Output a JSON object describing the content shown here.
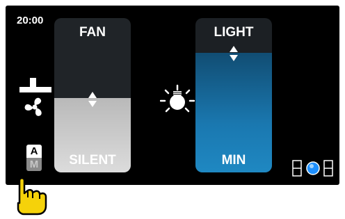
{
  "status": {
    "time": "20:00"
  },
  "fan": {
    "title": "FAN",
    "value_label": "SILENT",
    "level_percent": 48
  },
  "light": {
    "title": "LIGHT",
    "value_label": "MIN",
    "level_percent": 77
  },
  "mode": {
    "auto_label": "A",
    "manual_label": "M"
  },
  "icons": {
    "fan": "fan-icon",
    "light": "lightbulb-icon",
    "hand": "pointing-hand-icon",
    "indicator": "page-indicator-icon"
  },
  "colors": {
    "fan_fill": "#c8c8c8",
    "light_fill": "#1a78b0",
    "indicator_dot": "#1e90ff",
    "hand": "#f5d20a"
  }
}
